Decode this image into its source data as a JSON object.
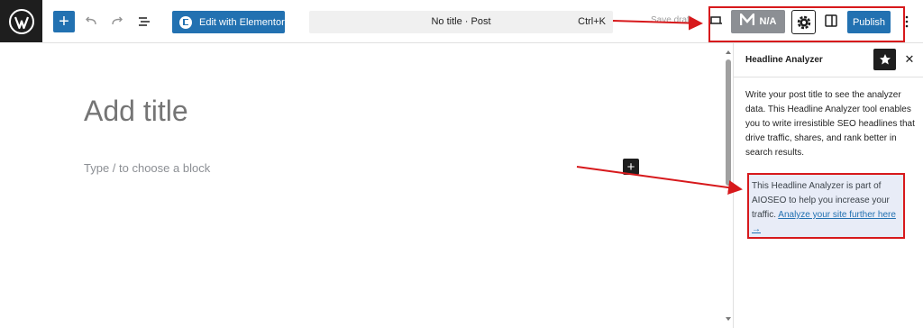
{
  "toolbar": {
    "add_block_symbol": "+",
    "elementor_label": "Edit with Elementor",
    "document_title": "No title · Post",
    "shortcut": "Ctrl+K",
    "save_draft_label": "Save draft",
    "aioseo_score_label": "N/A",
    "publish_label": "Publish"
  },
  "editor": {
    "title_placeholder": "Add title",
    "block_placeholder": "Type / to choose a block",
    "inserter_symbol": "+"
  },
  "panel": {
    "title": "Headline Analyzer",
    "close_symbol": "✕",
    "description": "Write your post title to see the analyzer data. This Headline Analyzer tool enables you to write irresistible SEO headlines that drive traffic, shares, and rank better in search results.",
    "promo_text": "This Headline Analyzer is part of AIOSEO to help you increase your traffic.",
    "promo_link": "Analyze your site further here →"
  },
  "icons": {
    "logo": "wordpress-logo-icon",
    "undo": "undo-icon",
    "redo": "redo-icon",
    "list_view": "list-view-icon",
    "view": "view-icon",
    "settings": "gear-icon",
    "sidebar": "sidebar-toggle-icon",
    "star": "star-icon",
    "more": "more-vertical-icon"
  },
  "colors": {
    "primary": "#2271b1",
    "dark": "#1e1e1e",
    "aioseo_gray": "#8c8f94",
    "annotation_red": "#d7191c",
    "promo_bg": "#e8ecf7"
  }
}
